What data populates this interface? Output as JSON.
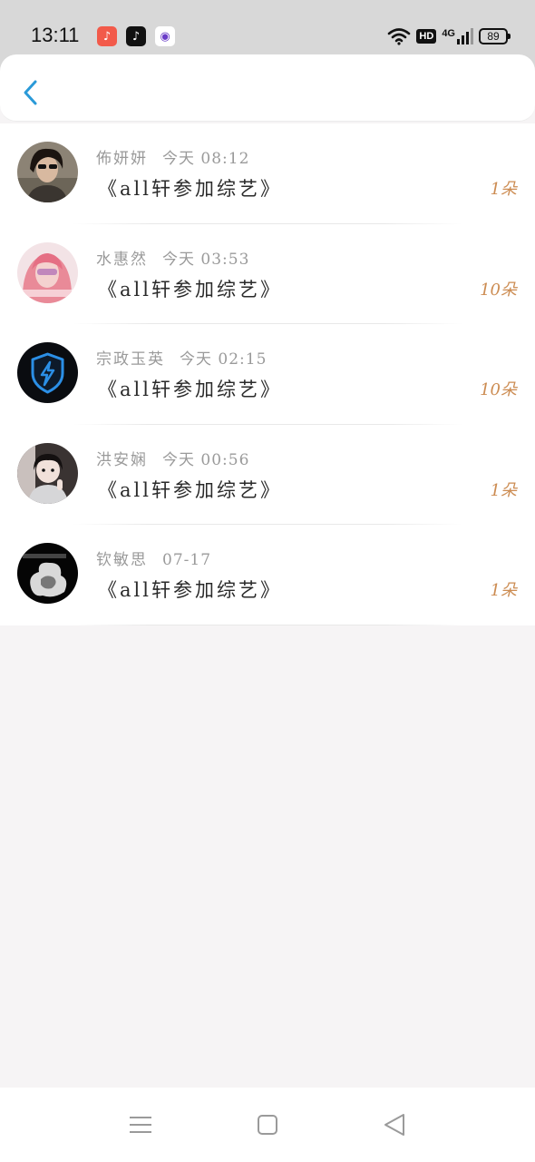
{
  "status_bar": {
    "time": "13:11",
    "apps": [
      {
        "name": "music-app-icon",
        "color": "#f25a4a",
        "glyph": "♪"
      },
      {
        "name": "tiktok-app-icon",
        "color": "#111111",
        "glyph": "♪"
      },
      {
        "name": "camera-app-icon",
        "color": "#ffffff",
        "glyph": "◉"
      }
    ],
    "hd": "HD",
    "network": "4G",
    "battery": "89"
  },
  "nav": {
    "back_icon": "chevron-left-icon",
    "accent": "#2a9ad8"
  },
  "messages": [
    {
      "name": "佈妍妍",
      "time": "今天 08:12",
      "title": "《all轩参加综艺》",
      "count": "1朵",
      "avatar": "dark-haired-man"
    },
    {
      "name": "水惠然",
      "time": "今天 03:53",
      "title": "《all轩参加综艺》",
      "count": "10朵",
      "avatar": "pink-hair-girl"
    },
    {
      "name": "宗政玉英",
      "time": "今天 02:15",
      "title": "《all轩参加综艺》",
      "count": "10朵",
      "avatar": "lightning-shield"
    },
    {
      "name": "洪安娴",
      "time": "今天 00:56",
      "title": "《all轩参加综艺》",
      "count": "1朵",
      "avatar": "child-photo"
    },
    {
      "name": "钦敏思",
      "time": "07-17",
      "title": "《all轩参加综艺》",
      "count": "1朵",
      "avatar": "smoke-black"
    }
  ],
  "count_color": "#cc8c52",
  "system_nav": [
    "menu-button",
    "home-button",
    "back-triangle-button"
  ]
}
